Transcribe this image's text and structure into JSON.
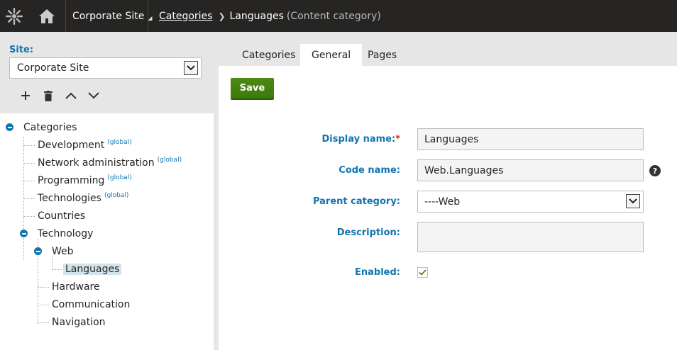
{
  "header": {
    "site_name": "Corporate Site",
    "breadcrumb": {
      "parent": "Categories",
      "current": "Languages",
      "current_type": "(Content category)"
    },
    "icons": [
      "kentico-logo-icon",
      "home-icon",
      "dropdown-triangle-icon",
      "breadcrumb-separator-icon"
    ]
  },
  "sidebar": {
    "site_label": "Site:",
    "site_value": "Corporate Site",
    "tools": [
      "add-icon",
      "delete-icon",
      "move-up-icon",
      "move-down-icon"
    ],
    "tree": {
      "root": "Categories",
      "global_tag": "(global)",
      "items": [
        {
          "label": "Development",
          "global": true
        },
        {
          "label": "Network administration",
          "global": true
        },
        {
          "label": "Programming",
          "global": true
        },
        {
          "label": "Technologies",
          "global": true
        },
        {
          "label": "Countries",
          "global": false
        },
        {
          "label": "Technology",
          "global": false
        },
        {
          "label": "Web",
          "global": false
        },
        {
          "label": "Languages",
          "global": false
        },
        {
          "label": "Hardware",
          "global": false
        },
        {
          "label": "Communication",
          "global": false
        },
        {
          "label": "Navigation",
          "global": false
        }
      ]
    }
  },
  "tabs": [
    {
      "label": "Categories",
      "active": false
    },
    {
      "label": "General",
      "active": true
    },
    {
      "label": "Pages",
      "active": false
    }
  ],
  "form": {
    "save_label": "Save",
    "display_name": {
      "label": "Display name:",
      "required_mark": "*",
      "value": "Languages"
    },
    "code_name": {
      "label": "Code name:",
      "value": "Web.Languages",
      "help": "?"
    },
    "parent_category": {
      "label": "Parent category:",
      "value": "----Web"
    },
    "description": {
      "label": "Description:",
      "value": ""
    },
    "enabled": {
      "label": "Enabled:",
      "checked": true
    }
  },
  "colors": {
    "topbar": "#262524",
    "accent_blue": "#1175ae",
    "save_green": "#4c8a14",
    "panel_gray": "#e6e6e6",
    "selected_node": "#d2e3ec"
  }
}
